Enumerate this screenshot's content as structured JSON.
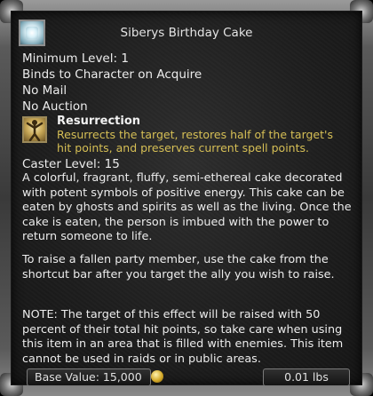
{
  "item": {
    "name": "Siberys Birthday Cake",
    "properties": [
      "Minimum Level: 1",
      "Binds to Character on Acquire",
      "No Mail",
      "No Auction"
    ]
  },
  "spell": {
    "name": "Resurrection",
    "description": "Resurrects the target, restores half of the target's hit points, and preserves current spell points.",
    "caster_level": "Caster Level: 15"
  },
  "description": {
    "para1": "A colorful, fragrant, fluffy, semi-ethereal cake decorated with potent symbols of positive energy. This cake can be eaten by ghosts and spirits as well as the living. Once the cake is eaten, the person is imbued with the power to return someone to life.",
    "para2": "To raise a fallen party member, use the cake from the shortcut bar after you target the ally you wish to raise.",
    "para3": "NOTE: The target of this effect will be raised with 50 percent of their total hit points, so take care when using this item in an area that is filled with enemies. This item cannot be used in raids or in public areas."
  },
  "footer": {
    "base_value": "Base Value: 15,000",
    "weight": "0.01 lbs"
  },
  "icons": {
    "item_icon": "cake-icon",
    "spell_icon": "resurrection-icon",
    "currency_icon": "coin-icon"
  }
}
